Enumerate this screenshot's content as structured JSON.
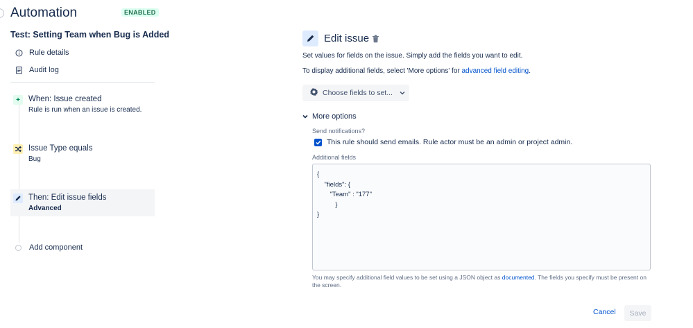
{
  "header": {
    "title": "Automation",
    "status_badge": "ENABLED",
    "rule_name": "Test: Setting Team when Bug is Added"
  },
  "nav": {
    "rule_details": "Rule details",
    "audit_log": "Audit log"
  },
  "steps": [
    {
      "title": "When: Issue created",
      "subtitle": "Rule is run when an issue is created.",
      "icon": "plus-icon",
      "icon_color": "#e3fcef"
    },
    {
      "title": "Issue Type equals",
      "subtitle": "Bug",
      "icon": "shuffle-icon",
      "icon_color": "#fff0b3"
    },
    {
      "title": "Then: Edit issue fields",
      "subtitle": "Advanced",
      "icon": "pencil-icon",
      "icon_color": "#deebff"
    }
  ],
  "add_component": "Add component",
  "editor": {
    "title": "Edit issue",
    "desc1": "Set values for fields on the issue. Simply add the fields you want to edit.",
    "desc2_prefix": "To display additional fields, select 'More options' for ",
    "desc2_link": "advanced field editing",
    "desc2_suffix": ".",
    "choose_fields": "Choose fields to set...",
    "more_options": "More options",
    "send_notifications_label": "Send notifications?",
    "checkbox_label": "This rule should send emails. Rule actor must be an admin or project admin.",
    "checkbox_checked": true,
    "additional_fields_label": "Additional fields",
    "additional_fields_value": "{\n    \"fields\": {\n       \"Team\" : \"177\"\n          }\n}",
    "help_prefix": "You may specify additional field values to be set using a JSON object as ",
    "help_link": "documented",
    "help_suffix": ". The fields you specify must be present on the screen.",
    "cancel": "Cancel",
    "save": "Save"
  },
  "colors": {
    "accent": "#0052cc",
    "badge_bg": "#dcfff1",
    "badge_text": "#216e4e"
  }
}
